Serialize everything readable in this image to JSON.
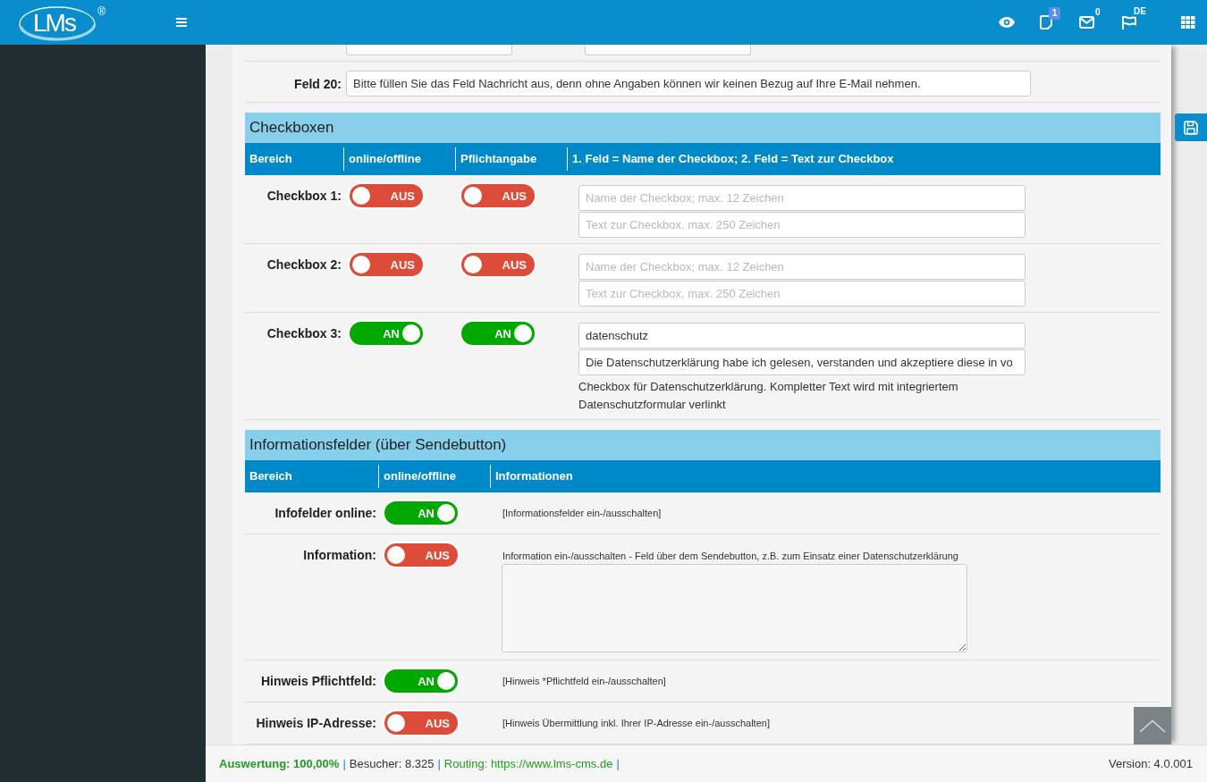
{
  "header": {
    "logo": {
      "text": "LMs",
      "mark": "®"
    },
    "tablet_badge": "1",
    "mail_count": "0",
    "language": "DE"
  },
  "form": {
    "field_20": {
      "label": "Feld 20:",
      "value": "Bitte füllen Sie das Feld Nachricht aus, denn ohne Angaben können wir keinen Bezug auf Ihre E-Mail nehmen."
    }
  },
  "checkboxes": {
    "title": "Checkboxen",
    "columns": [
      "Bereich",
      "online/offline",
      "Pflichtangabe",
      "1. Feld = Name der Checkbox; 2. Feld = Text zur Checkbox"
    ],
    "rows": [
      {
        "label": "Checkbox 1:",
        "online": {
          "on": false,
          "label": "AUS"
        },
        "required": {
          "on": false,
          "label": "AUS"
        },
        "name_field": {
          "placeholder": "Name der Checkbox; max. 12 Zeichen"
        },
        "text_field": {
          "placeholder": "Text zur Checkbox, max. 250 Zeichen"
        }
      },
      {
        "label": "Checkbox 2:",
        "online": {
          "on": false,
          "label": "AUS"
        },
        "required": {
          "on": false,
          "label": "AUS"
        },
        "name_field": {
          "placeholder": "Name der Checkbox; max. 12 Zeichen"
        },
        "text_field": {
          "placeholder": "Text zur Checkbox, max. 250 Zeichen"
        }
      },
      {
        "label": "Checkbox 3:",
        "online": {
          "on": true,
          "label": "AN"
        },
        "required": {
          "on": true,
          "label": "AN"
        },
        "name_field": {
          "value": "datenschutz"
        },
        "text_field": {
          "value": "Die Datenschutzerklärung habe ich gelesen, verstanden und akzeptiere diese in vo"
        },
        "hint": "Checkbox für Datenschutzerklärung. Kompletter Text wird mit integriertem Datenschutzformular verlinkt"
      }
    ]
  },
  "info_fields": {
    "title": "Informationsfelder (über Sendebutton)",
    "columns": [
      "Bereich",
      "online/offline",
      "Informationen"
    ],
    "rows": [
      {
        "kind": "plain",
        "label": "Infofelder online:",
        "toggle": {
          "on": true,
          "label": "AN"
        },
        "info": "[Informationsfelder ein-/ausschalten]"
      },
      {
        "kind": "textarea",
        "label": "Information:",
        "toggle": {
          "on": false,
          "label": "AUS"
        },
        "info": "Information ein-/ausschalten - Feld über dem Sendebutton, z.B. zum Einsatz einer Datenschutzerklärung"
      },
      {
        "kind": "plain",
        "label": "Hinweis Pflichtfeld:",
        "toggle": {
          "on": true,
          "label": "AN"
        },
        "info": "[Hinweis *Pflichtfeld ein-/ausschalten]"
      },
      {
        "kind": "plain",
        "label": "Hinweis IP-Adresse:",
        "toggle": {
          "on": false,
          "label": "AUS"
        },
        "info": "[Hinweis Übermittlung inkl. Ihrer IP-Adresse ein-/ausschalten]"
      }
    ]
  },
  "status_bar": {
    "items": [
      {
        "kind": "score",
        "text": "Auswertung: 100,00%"
      },
      {
        "kind": "plain",
        "text": "Besucher: 8.325"
      },
      {
        "kind": "link",
        "text": "Routing: https://www.lms-cms.de"
      }
    ],
    "separator": "|",
    "version": "Version: 4.0.001"
  }
}
